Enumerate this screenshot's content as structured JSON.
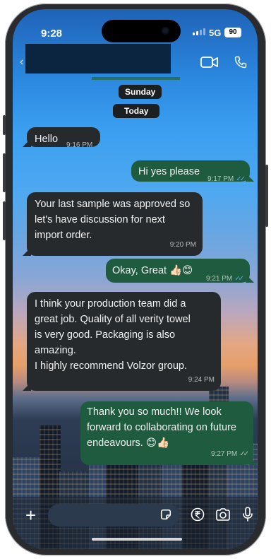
{
  "status_bar": {
    "time": "9:28",
    "network": "5G",
    "battery": "90"
  },
  "header": {
    "icons": [
      "back-arrow-icon",
      "video-call-icon",
      "phone-call-icon"
    ]
  },
  "date_chips": {
    "sunday": "Sunday",
    "today": "Today"
  },
  "messages": [
    {
      "direction": "in",
      "text": "Hello",
      "time": "9:16 PM"
    },
    {
      "direction": "out",
      "text": "Hi yes please",
      "time": "9:17 PM",
      "read": true
    },
    {
      "direction": "in",
      "lines": [
        "Your last sample was approved so",
        "let's have discussion for next",
        "import order."
      ],
      "time": "9:20 PM"
    },
    {
      "direction": "out",
      "text": "Okay, Great 👍🏻😊",
      "time": "9:21 PM",
      "read": true
    },
    {
      "direction": "in",
      "lines": [
        "I think your production team did a",
        "great job. Quality of all verity towel",
        "is very good. Packaging is also",
        "amazing.",
        "I highly recommend Volzor group."
      ],
      "time": "9:24 PM"
    },
    {
      "direction": "out",
      "lines": [
        "Thank you so much!! We look",
        "forward to collaborating on future",
        "endeavours. 😊👍🏻"
      ],
      "time": "9:27 PM",
      "read": false
    }
  ],
  "input_bar": {
    "icons": [
      "plus-icon",
      "sticker-icon",
      "rupee-payment-icon",
      "camera-icon",
      "microphone-icon"
    ]
  },
  "colors": {
    "incoming_bubble": "#262a2d",
    "outgoing_bubble": "#1f5b3f",
    "read_tick": "#54a9e6"
  }
}
